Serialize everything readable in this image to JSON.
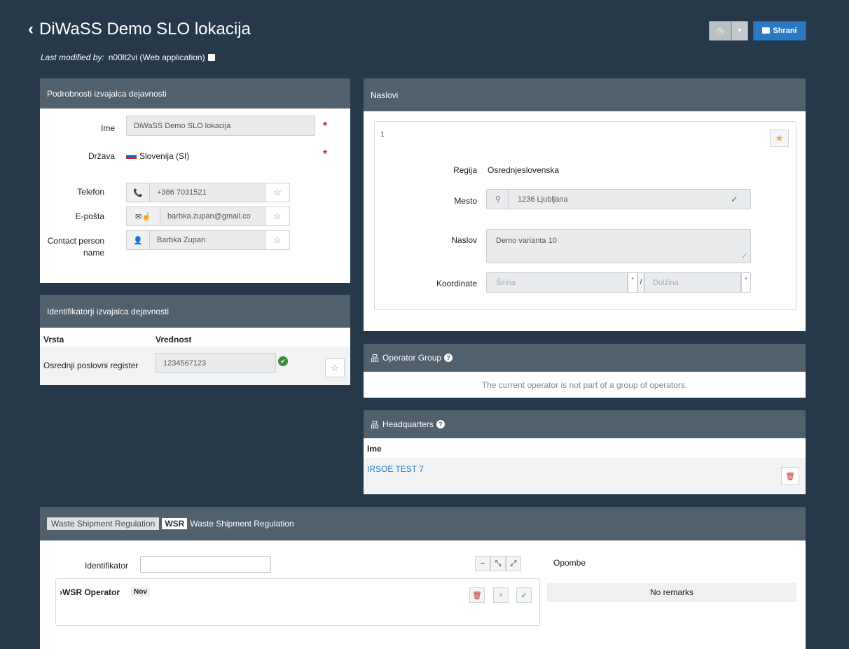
{
  "header": {
    "back_icon": "‹",
    "title": "DiWaSS Demo SLO lokacija",
    "last_modified_label": "Last modified by:",
    "last_modified_value": "n00lt2vi (Web application)",
    "history_icon": "◷",
    "dropdown_icon": "▾",
    "save_label": "Shrani"
  },
  "details": {
    "heading": "Podrobnosti izvajalca dejavnosti",
    "name_label": "Ime",
    "name_value": "DiWaSS Demo SLO lokacija",
    "country_label": "Država",
    "country_value": "Slovenija (SI)",
    "phone_label": "Telefon",
    "phone_value": "+386 7031521",
    "email_label": "E-pošta",
    "email_value": "barbka.zupan@gmail.co",
    "contact_label_1": "Contact person",
    "contact_label_2": "name",
    "contact_value": "Barbka Zupan",
    "required_mark": "*",
    "star_icon": "☆"
  },
  "identifiers": {
    "heading": "Identifikatorji izvajalca dejavnosti",
    "col_type": "Vrsta",
    "col_value": "Vrednost",
    "row_type": "Osrednji poslovni register",
    "row_value": "1234567123",
    "ok_icon": "✔"
  },
  "addresses": {
    "heading": "Naslovi",
    "index": "1",
    "region_label": "Regija",
    "region_value": "Osrednjeslovenska",
    "city_label": "Mesto",
    "city_value": "1236 Ljubljana",
    "address_label": "Naslov",
    "address_value": "Demo varianta 10",
    "coords_label": "Koordinate",
    "lat_placeholder": "Širina",
    "lon_placeholder": "Dolžina",
    "degree": "°",
    "slash": "/",
    "check_icon": "✓",
    "search_icon": "⚲",
    "star_icon": "★"
  },
  "operator_group": {
    "heading": "Operator Group",
    "message": "The current operator is not part of a group of operators."
  },
  "headquarters": {
    "heading": "Headquarters",
    "col_name": "Ime",
    "row_name": "IRSOE TEST 7",
    "delete_icon": "🗑"
  },
  "wsr": {
    "tag_label": "Waste Shipment Regulation",
    "abbr": "WSR",
    "title": "Waste Shipment Regulation",
    "identifier_label": "Identifikator",
    "identifier_value": "",
    "operator_label": "WSR Operator",
    "new_badge": "Nov",
    "remarks_label": "Opombe",
    "no_remarks": "No remarks",
    "minus_icon": "−",
    "collapse_icon": "⤡",
    "expand_icon": "⤢",
    "pause_icon": "⏸",
    "check_icon": "✓",
    "delete_icon": "🗑"
  },
  "colors": {
    "background": "#25394a",
    "panel_header": "#50606d",
    "primary": "#2a79c2",
    "required": "#c0282d",
    "star_active": "#f0ad4e",
    "success": "#3c8a3c"
  }
}
